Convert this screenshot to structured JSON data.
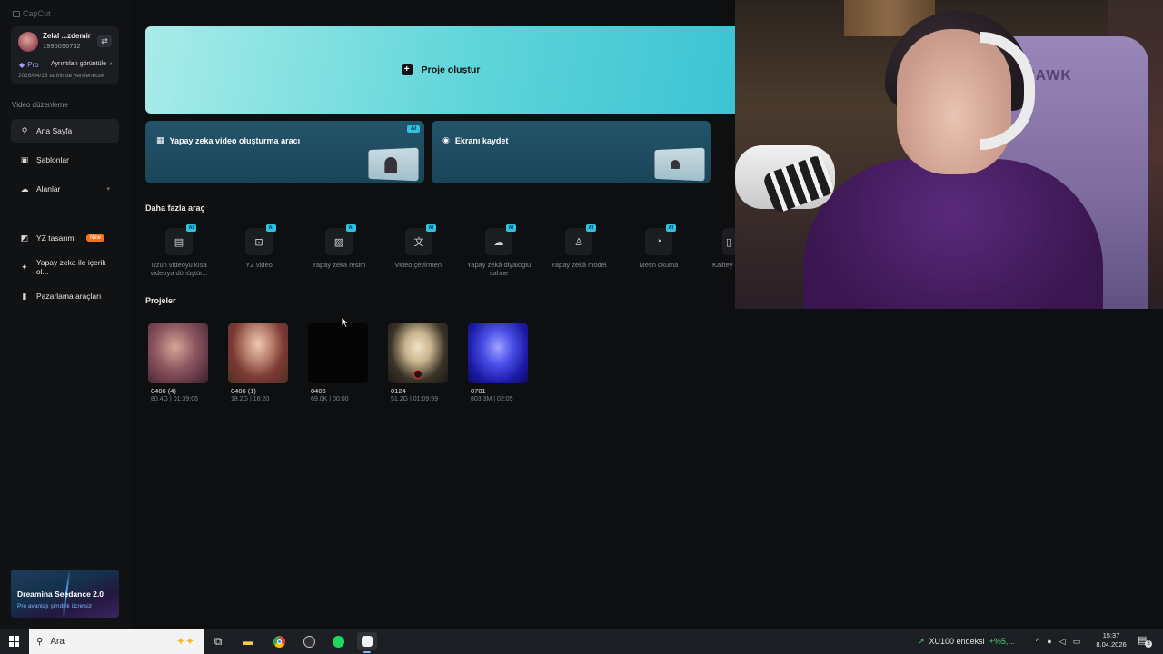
{
  "app": {
    "name": "CapCut"
  },
  "account": {
    "name": "Zelal ...zdemir",
    "id": "1996096732",
    "plan": "Pro",
    "details_label": "Ayrıntıları görüntüle",
    "renew_text": "2026/04/16 tarihinde yenilenecek"
  },
  "sidebar": {
    "section_label": "Video düzenleme",
    "items": [
      {
        "label": "Ana Sayfa",
        "icon": "home-icon"
      },
      {
        "label": "Şablonlar",
        "icon": "template-icon"
      },
      {
        "label": "Alanlar",
        "icon": "cloud-icon"
      },
      {
        "label": "YZ tasarımı",
        "icon": "ai-design-icon",
        "badge": "New"
      },
      {
        "label": "Yapay zeka ile içerik ol...",
        "icon": "sparkle-icon"
      },
      {
        "label": "Pazarlama araçları",
        "icon": "marketing-icon"
      }
    ],
    "promo": {
      "title": "Dreamina Seedance 2.0",
      "subtitle": "Pro avantajı şimdilik ücretsiz"
    }
  },
  "hero": {
    "create_label": "Proje oluştur"
  },
  "feature_cards": [
    {
      "label": "Yapay zeka video oluşturma aracı",
      "badge": "AI"
    },
    {
      "label": "Ekranı kaydet"
    }
  ],
  "tools_section": {
    "title": "Daha fazla araç",
    "badge": "AI",
    "items": [
      {
        "label": "Uzun videoyu kısa videoya dönüştür...",
        "icon": "film-icon"
      },
      {
        "label": "YZ video",
        "icon": "video-plus-icon"
      },
      {
        "label": "Yapay zeka resim",
        "icon": "image-ai-icon"
      },
      {
        "label": "Video çevirmeni",
        "icon": "translate-icon"
      },
      {
        "label": "Yapay zekâ diyaloglu sahne",
        "icon": "dialog-scene-icon"
      },
      {
        "label": "Yapay zekâ model",
        "icon": "model-icon"
      },
      {
        "label": "Metin okuma",
        "icon": "speech-icon"
      },
      {
        "label": "Kalitey",
        "icon": "quality-icon"
      }
    ]
  },
  "projects_section": {
    "title": "Projeler",
    "items": [
      {
        "name": "0406 (4)",
        "meta": "80.4G | 01:39:06"
      },
      {
        "name": "0406 (1)",
        "meta": "18.2G | 16:20"
      },
      {
        "name": "0406",
        "meta": "69.0K | 00:00"
      },
      {
        "name": "0124",
        "meta": "51.2G | 01:09:59"
      },
      {
        "name": "0701",
        "meta": "803.3M | 02:05"
      }
    ]
  },
  "webcam": {
    "chair_text": "HAWK"
  },
  "taskbar": {
    "search_placeholder": "Ara",
    "stock_name": "XU100 endeksi",
    "stock_change": "+%5,...",
    "time": "15:37",
    "date": "8.04.2026",
    "notification_count": "3"
  },
  "colors": {
    "accent": "#2fc2e0",
    "hero_start": "#a8ece9",
    "hero_end": "#3cc3d4",
    "new_badge": "#f2711c",
    "stock_up": "#4fd16b"
  }
}
